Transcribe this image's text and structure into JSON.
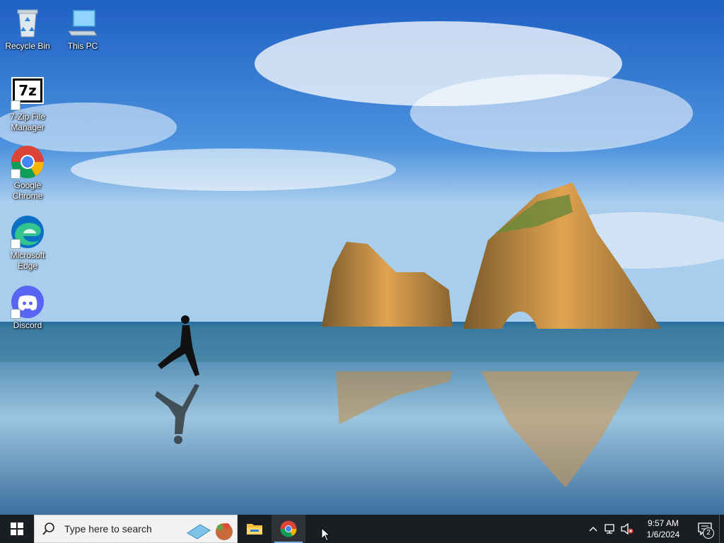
{
  "desktop": {
    "icons": [
      {
        "label": "Recycle Bin",
        "icon": "recycle-bin-icon"
      },
      {
        "label": "This PC",
        "icon": "this-pc-icon"
      },
      {
        "label": "7-Zip File Manager",
        "icon": "7zip-icon"
      },
      {
        "label": "Google Chrome",
        "icon": "chrome-icon"
      },
      {
        "label": "Microsoft Edge",
        "icon": "edge-icon"
      },
      {
        "label": "Discord",
        "icon": "discord-icon"
      }
    ],
    "sevenzip_glyph": "7z"
  },
  "taskbar": {
    "search_placeholder": "Type here to search",
    "apps": [
      {
        "name": "File Explorer",
        "icon": "file-explorer-icon"
      },
      {
        "name": "Google Chrome",
        "icon": "chrome-icon",
        "active": true
      }
    ],
    "clock": {
      "time": "9:57 AM",
      "date": "1/6/2024"
    },
    "notification_count": "2"
  },
  "colors": {
    "taskbar_bg": "#1a1d22",
    "discord": "#5865F2",
    "accent": "#7fb0e6"
  }
}
